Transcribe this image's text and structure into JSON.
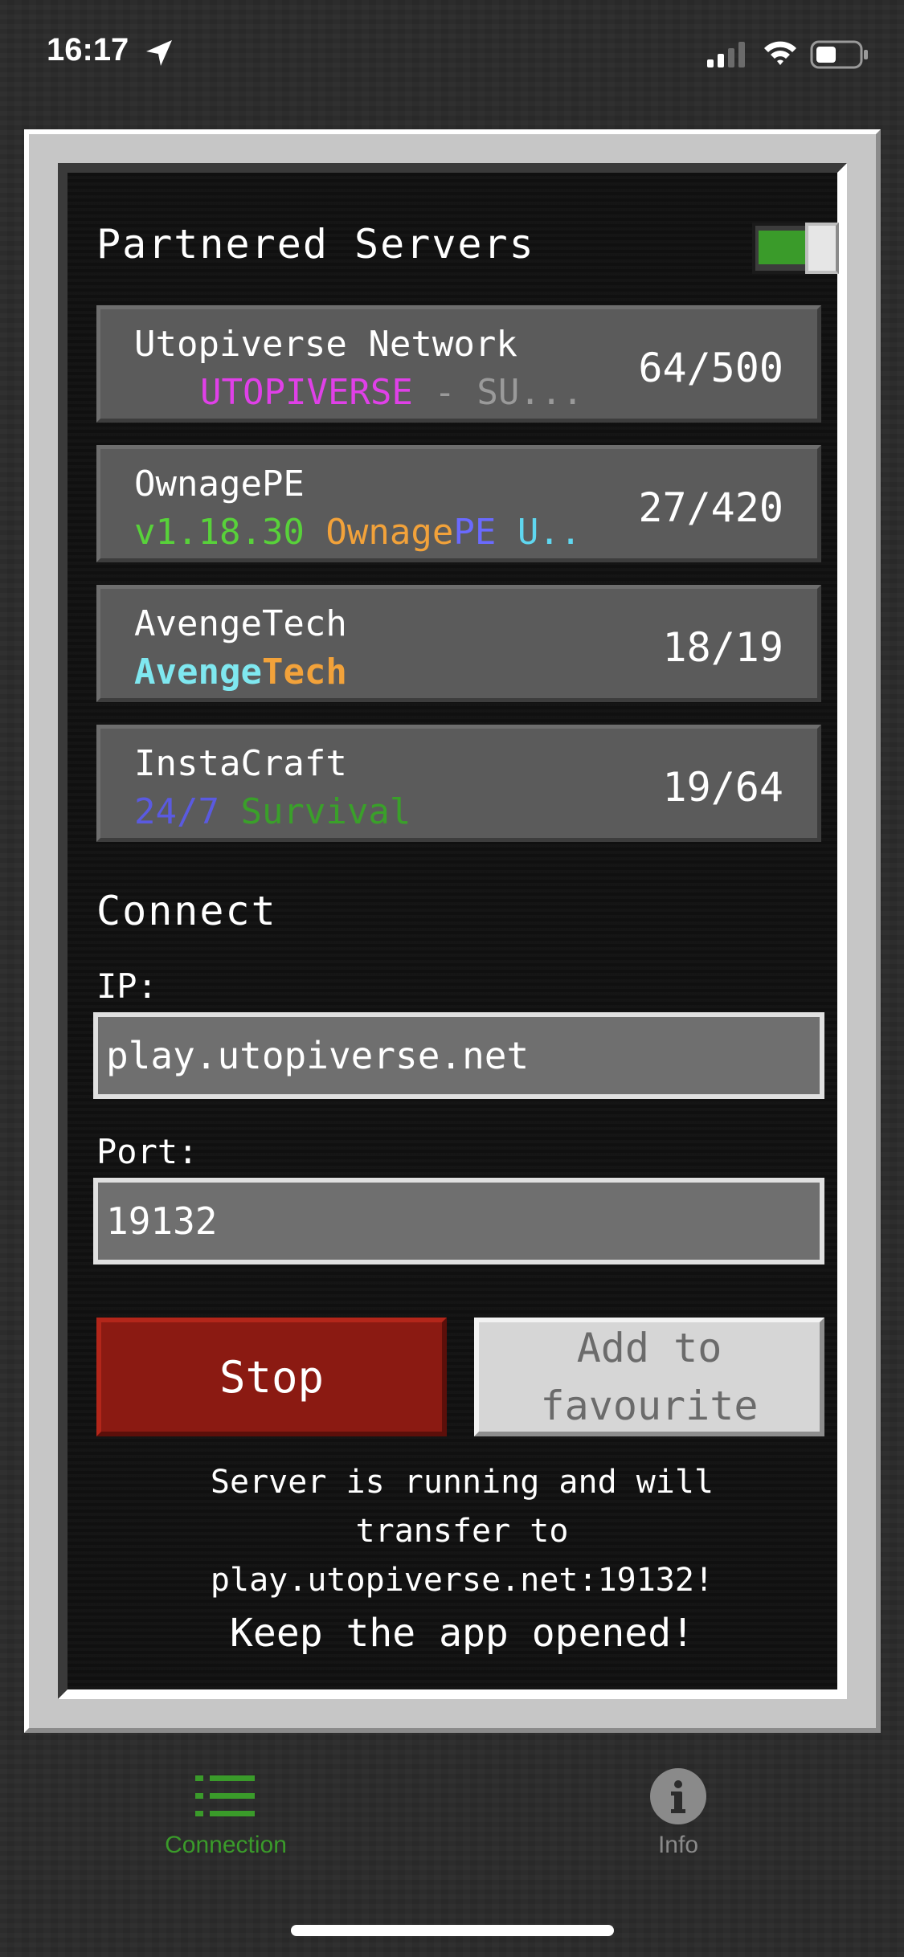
{
  "status_bar": {
    "time": "16:17",
    "icons": [
      "location-arrow-icon",
      "cellular-signal-icon",
      "wifi-icon",
      "battery-icon"
    ]
  },
  "partnered": {
    "title": "Partnered Servers",
    "toggle_on": true,
    "servers": [
      {
        "name": "Utopiverse Network",
        "motd": [
          {
            "text": "UTOPIVERSE",
            "color": "#e040e8"
          },
          {
            "text": " - SU...",
            "color": "#9a9a9a"
          }
        ],
        "players": "64/500"
      },
      {
        "name": "OwnagePE",
        "motd": [
          {
            "text": "v1.18.30 ",
            "color": "#58d23a"
          },
          {
            "text": "Ownage",
            "color": "#f2a23a"
          },
          {
            "text": "PE ",
            "color": "#6a6aff"
          },
          {
            "text": "U...",
            "color": "#5fd7f0"
          }
        ],
        "players": "27/420"
      },
      {
        "name": "AvengeTech",
        "motd": [
          {
            "text": "Avenge",
            "color": "#7fe8f0"
          },
          {
            "text": "Tech",
            "color": "#f2a23a"
          }
        ],
        "players": "18/19"
      },
      {
        "name": "InstaCraft",
        "motd": [
          {
            "text": "24/7 ",
            "color": "#5a5ae0"
          },
          {
            "text": "Survival",
            "color": "#3aa02a"
          }
        ],
        "players": "19/64"
      }
    ]
  },
  "connect": {
    "title": "Connect",
    "ip_label": "IP:",
    "ip_value": "play.utopiverse.net",
    "port_label": "Port:",
    "port_value": "19132",
    "stop_label": "Stop",
    "favourite_label": "Add to favourite",
    "status_line1": "Server is running and will",
    "status_line2": "transfer to",
    "status_line3": "play.utopiverse.net:19132!",
    "status_line4": "Keep the app opened!"
  },
  "tabs": {
    "connection": {
      "label": "Connection",
      "icon": "list-icon",
      "color": "#3a9b2a",
      "active": true
    },
    "info": {
      "label": "Info",
      "icon": "info-icon",
      "color": "#8a8a8a",
      "active": false
    }
  }
}
